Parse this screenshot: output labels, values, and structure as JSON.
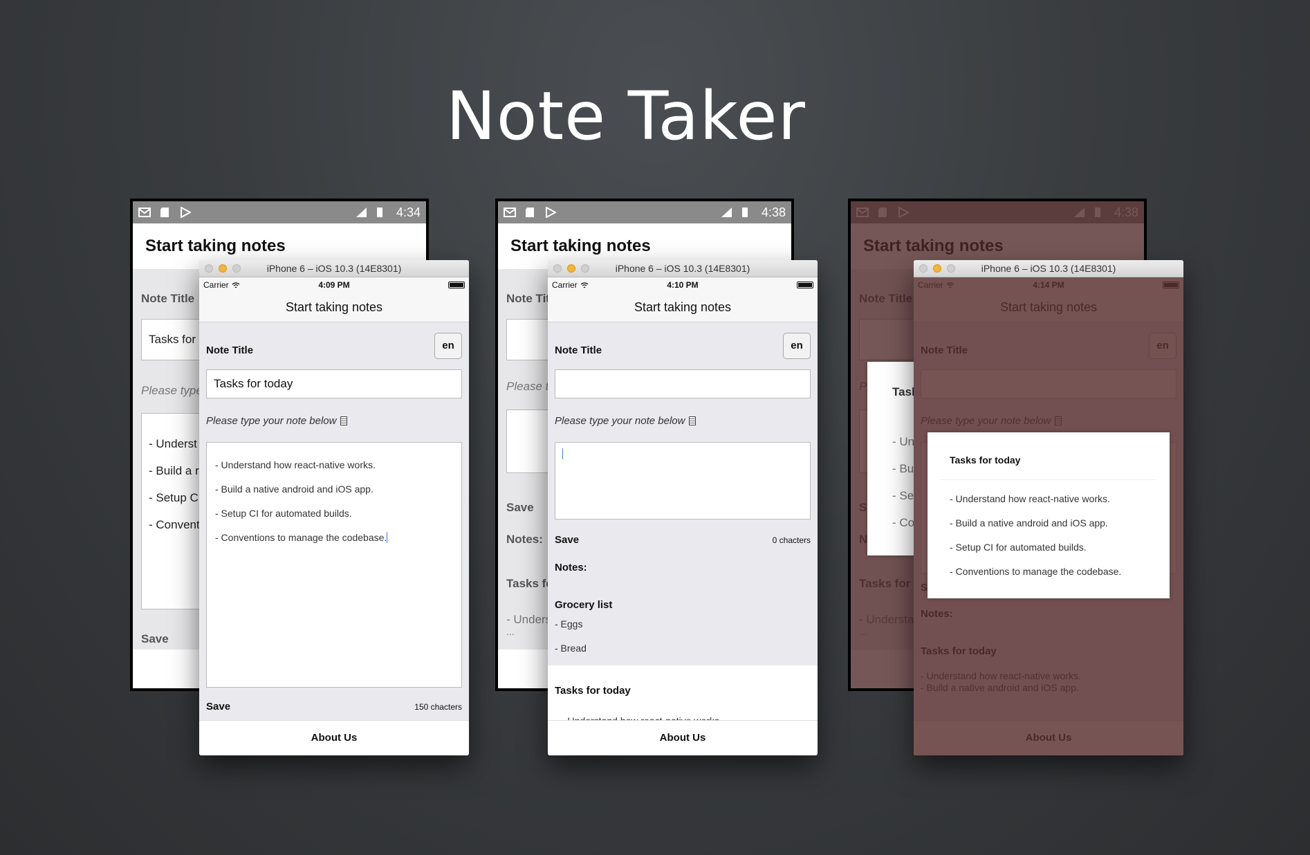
{
  "hero": {
    "title": "Note Taker"
  },
  "android": [
    {
      "time": "4:34",
      "header": "Start taking notes",
      "note_title_label": "Note Title",
      "title_value": "Tasks for",
      "placeholder": "Please type",
      "lines": [
        "- Underst",
        "- Build  a r",
        "- Setup CI",
        "- Conventi"
      ],
      "save": "Save"
    },
    {
      "time": "4:38",
      "header": "Start taking notes",
      "note_title_label": "Note Tit",
      "placeholder": "Please ty",
      "save": "Save",
      "notes": "Notes:",
      "list_title": "Tasks fo",
      "list_lines": [
        "- Unders",
        "..."
      ]
    },
    {
      "time": "4:38",
      "header": "Start taking notes",
      "note_title_label": "Note Title",
      "placeholder": "P",
      "modal_title": "Task",
      "modal_lines": [
        "- Un",
        "- Bui",
        "- Set",
        "- Co"
      ],
      "save": "S",
      "notes": "N",
      "list_title": "Tasks for t",
      "list_lines": [
        "- Understa",
        "..."
      ]
    }
  ],
  "ios": [
    {
      "sim_title": "iPhone 6 – iOS 10.3 (14E8301)",
      "carrier": "Carrier",
      "time": "4:09 PM",
      "nav_title": "Start taking notes",
      "note_title_label": "Note Title",
      "lang_button": "en",
      "title_value": "Tasks for today",
      "note_prompt": "Please type your note below",
      "note_lines": [
        "- Understand how react-native works.",
        "- Build  a native android and iOS app.",
        "- Setup CI for automated builds.",
        "- Conventions to manage the codebase."
      ],
      "save": "Save",
      "char_count": "150 chacters",
      "tab": "About Us"
    },
    {
      "sim_title": "iPhone 6 – iOS 10.3 (14E8301)",
      "carrier": "Carrier",
      "time": "4:10 PM",
      "nav_title": "Start taking notes",
      "note_title_label": "Note Title",
      "lang_button": "en",
      "title_value": "",
      "note_prompt": "Please type your note below",
      "save": "Save",
      "char_count": "0 chacters",
      "notes_heading": "Notes:",
      "notes": [
        {
          "title": "Grocery list",
          "lines": [
            "- Eggs",
            "- Bread"
          ]
        },
        {
          "title": "Tasks for today",
          "lines": [
            "- Understand how react-native works."
          ]
        }
      ],
      "tab": "About Us"
    },
    {
      "sim_title": "iPhone 6 – iOS 10.3 (14E8301)",
      "carrier": "Carrier",
      "time": "4:14 PM",
      "nav_title": "Start taking notes",
      "note_title_label": "Note Title",
      "lang_button": "en",
      "note_prompt": "Please type your note below",
      "save": "Save",
      "notes_heading": "Notes:",
      "list_title": "Tasks for today",
      "list_lines": [
        "- Understand how react-native works.",
        "- Build  a native android and iOS app."
      ],
      "modal_title": "Tasks for today",
      "modal_lines": [
        "- Understand how react-native works.",
        "- Build  a native android and iOS app.",
        "- Setup CI for automated builds.",
        "- Conventions to manage the codebase."
      ],
      "tab": "About Us"
    }
  ]
}
